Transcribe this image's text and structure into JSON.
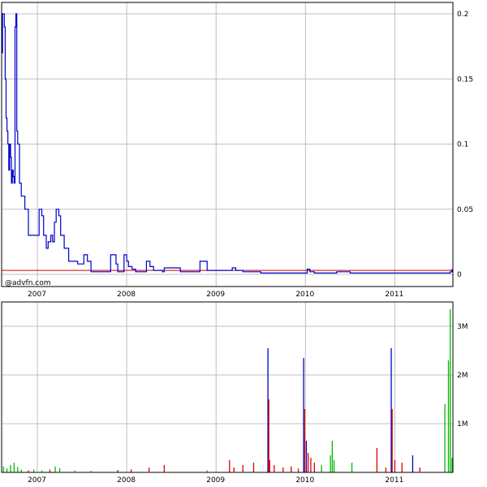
{
  "watermark": "@advfn.com",
  "colors": {
    "price_line": "#0000cc",
    "reference_line": "#cc0000",
    "volume_up": "#00bb00",
    "volume_down": "#dd0000",
    "volume_neutral": "#0000cc",
    "grid": "#c0c0c0",
    "frame": "#000000"
  },
  "chart_data": [
    {
      "type": "line",
      "title": "",
      "xlabel": "",
      "ylabel": "",
      "x_ticks": [
        "2007",
        "2008",
        "2009",
        "2010",
        "2011"
      ],
      "y_ticks": [
        "0",
        "0.05",
        "0.1",
        "0.15",
        "0.2"
      ],
      "ylim": [
        0,
        0.2
      ],
      "xlim": [
        2006.6,
        2011.65
      ],
      "grid": true,
      "reference_line": 0.003,
      "series": [
        {
          "x": [
            2006.6,
            2006.61,
            2006.62,
            2006.63,
            2006.64,
            2006.65,
            2006.66,
            2006.67,
            2006.68,
            2006.69,
            2006.7,
            2006.71,
            2006.72,
            2006.73,
            2006.74,
            2006.75,
            2006.76,
            2006.77,
            2006.78,
            2006.8,
            2006.82,
            2006.84,
            2006.86,
            2006.9,
            2006.93,
            2006.96,
            2006.98,
            2007.0,
            2007.02,
            2007.05,
            2007.07,
            2007.1,
            2007.12,
            2007.15,
            2007.17,
            2007.19,
            2007.21,
            2007.24,
            2007.26,
            2007.3,
            2007.35,
            2007.4,
            2007.45,
            2007.5,
            2007.52,
            2007.56,
            2007.6,
            2007.62,
            2007.7,
            2007.8,
            2007.82,
            2007.88,
            2007.9,
            2007.95,
            2007.97,
            2008.0,
            2008.02,
            2008.06,
            2008.1,
            2008.2,
            2008.22,
            2008.26,
            2008.3,
            2008.4,
            2008.42,
            2008.6,
            2008.7,
            2008.8,
            2008.82,
            2008.9,
            2009.0,
            2009.15,
            2009.18,
            2009.22,
            2009.3,
            2009.4,
            2009.5,
            2009.6,
            2009.7,
            2009.8,
            2009.9,
            2010.0,
            2010.02,
            2010.05,
            2010.1,
            2010.2,
            2010.3,
            2010.35,
            2010.4,
            2010.5,
            2010.6,
            2010.7,
            2010.8,
            2010.9,
            2011.0,
            2011.1,
            2011.2,
            2011.3,
            2011.4,
            2011.5,
            2011.6,
            2011.62,
            2011.64
          ],
          "y": [
            0.17,
            0.2,
            0.2,
            0.19,
            0.15,
            0.12,
            0.11,
            0.1,
            0.08,
            0.1,
            0.09,
            0.07,
            0.08,
            0.075,
            0.07,
            0.19,
            0.2,
            0.11,
            0.1,
            0.07,
            0.06,
            0.06,
            0.05,
            0.03,
            0.03,
            0.03,
            0.03,
            0.03,
            0.05,
            0.045,
            0.03,
            0.02,
            0.025,
            0.03,
            0.025,
            0.04,
            0.05,
            0.045,
            0.03,
            0.02,
            0.01,
            0.01,
            0.008,
            0.008,
            0.015,
            0.01,
            0.002,
            0.002,
            0.002,
            0.002,
            0.015,
            0.008,
            0.002,
            0.002,
            0.015,
            0.01,
            0.006,
            0.004,
            0.002,
            0.002,
            0.01,
            0.006,
            0.003,
            0.002,
            0.005,
            0.002,
            0.002,
            0.002,
            0.01,
            0.003,
            0.003,
            0.003,
            0.005,
            0.003,
            0.002,
            0.002,
            0.001,
            0.001,
            0.001,
            0.001,
            0.001,
            0.001,
            0.004,
            0.002,
            0.001,
            0.001,
            0.001,
            0.002,
            0.002,
            0.001,
            0.001,
            0.001,
            0.001,
            0.001,
            0.001,
            0.001,
            0.001,
            0.001,
            0.001,
            0.001,
            0.001,
            0.002,
            0.004
          ]
        }
      ]
    },
    {
      "type": "bar",
      "title": "",
      "xlabel": "",
      "ylabel": "",
      "x_ticks": [
        "2007",
        "2008",
        "2009",
        "2010",
        "2011"
      ],
      "y_ticks": [
        "1M",
        "2M",
        "3M"
      ],
      "ylim": [
        0,
        3500000
      ],
      "xlim": [
        2006.6,
        2011.65
      ],
      "grid": true,
      "bars": [
        {
          "x": 2006.62,
          "v": 120000,
          "c": "up"
        },
        {
          "x": 2006.66,
          "v": 80000,
          "c": "up"
        },
        {
          "x": 2006.7,
          "v": 150000,
          "c": "up"
        },
        {
          "x": 2006.74,
          "v": 200000,
          "c": "up"
        },
        {
          "x": 2006.78,
          "v": 110000,
          "c": "up"
        },
        {
          "x": 2006.82,
          "v": 60000,
          "c": "up"
        },
        {
          "x": 2006.9,
          "v": 40000,
          "c": "down"
        },
        {
          "x": 2006.96,
          "v": 60000,
          "c": "up"
        },
        {
          "x": 2007.05,
          "v": 40000,
          "c": "up"
        },
        {
          "x": 2007.14,
          "v": 60000,
          "c": "down"
        },
        {
          "x": 2007.2,
          "v": 120000,
          "c": "up"
        },
        {
          "x": 2007.25,
          "v": 90000,
          "c": "up"
        },
        {
          "x": 2007.42,
          "v": 40000,
          "c": "up"
        },
        {
          "x": 2007.6,
          "v": 30000,
          "c": "up"
        },
        {
          "x": 2007.9,
          "v": 50000,
          "c": "down"
        },
        {
          "x": 2008.05,
          "v": 60000,
          "c": "down"
        },
        {
          "x": 2008.25,
          "v": 100000,
          "c": "down"
        },
        {
          "x": 2008.42,
          "v": 150000,
          "c": "down"
        },
        {
          "x": 2008.9,
          "v": 40000,
          "c": "up"
        },
        {
          "x": 2009.15,
          "v": 250000,
          "c": "down"
        },
        {
          "x": 2009.2,
          "v": 100000,
          "c": "down"
        },
        {
          "x": 2009.3,
          "v": 150000,
          "c": "down"
        },
        {
          "x": 2009.42,
          "v": 200000,
          "c": "down"
        },
        {
          "x": 2009.58,
          "v": 2550000,
          "c": "neutral"
        },
        {
          "x": 2009.59,
          "v": 1500000,
          "c": "down"
        },
        {
          "x": 2009.6,
          "v": 250000,
          "c": "down"
        },
        {
          "x": 2009.65,
          "v": 150000,
          "c": "down"
        },
        {
          "x": 2009.75,
          "v": 100000,
          "c": "down"
        },
        {
          "x": 2009.84,
          "v": 120000,
          "c": "down"
        },
        {
          "x": 2009.92,
          "v": 80000,
          "c": "down"
        },
        {
          "x": 2009.98,
          "v": 2350000,
          "c": "neutral"
        },
        {
          "x": 2009.99,
          "v": 1300000,
          "c": "down"
        },
        {
          "x": 2010.01,
          "v": 650000,
          "c": "neutral"
        },
        {
          "x": 2010.03,
          "v": 400000,
          "c": "down"
        },
        {
          "x": 2010.06,
          "v": 300000,
          "c": "down"
        },
        {
          "x": 2010.1,
          "v": 200000,
          "c": "down"
        },
        {
          "x": 2010.18,
          "v": 150000,
          "c": "up"
        },
        {
          "x": 2010.28,
          "v": 350000,
          "c": "up"
        },
        {
          "x": 2010.3,
          "v": 650000,
          "c": "up"
        },
        {
          "x": 2010.32,
          "v": 250000,
          "c": "up"
        },
        {
          "x": 2010.52,
          "v": 200000,
          "c": "up"
        },
        {
          "x": 2010.8,
          "v": 500000,
          "c": "down"
        },
        {
          "x": 2010.9,
          "v": 100000,
          "c": "down"
        },
        {
          "x": 2010.96,
          "v": 2550000,
          "c": "neutral"
        },
        {
          "x": 2010.97,
          "v": 1300000,
          "c": "down"
        },
        {
          "x": 2011.0,
          "v": 250000,
          "c": "down"
        },
        {
          "x": 2011.08,
          "v": 200000,
          "c": "down"
        },
        {
          "x": 2011.2,
          "v": 350000,
          "c": "neutral"
        },
        {
          "x": 2011.28,
          "v": 100000,
          "c": "down"
        },
        {
          "x": 2011.56,
          "v": 1400000,
          "c": "up"
        },
        {
          "x": 2011.6,
          "v": 2300000,
          "c": "up"
        },
        {
          "x": 2011.62,
          "v": 3350000,
          "c": "up"
        },
        {
          "x": 2011.64,
          "v": 300000,
          "c": "up"
        }
      ]
    }
  ]
}
